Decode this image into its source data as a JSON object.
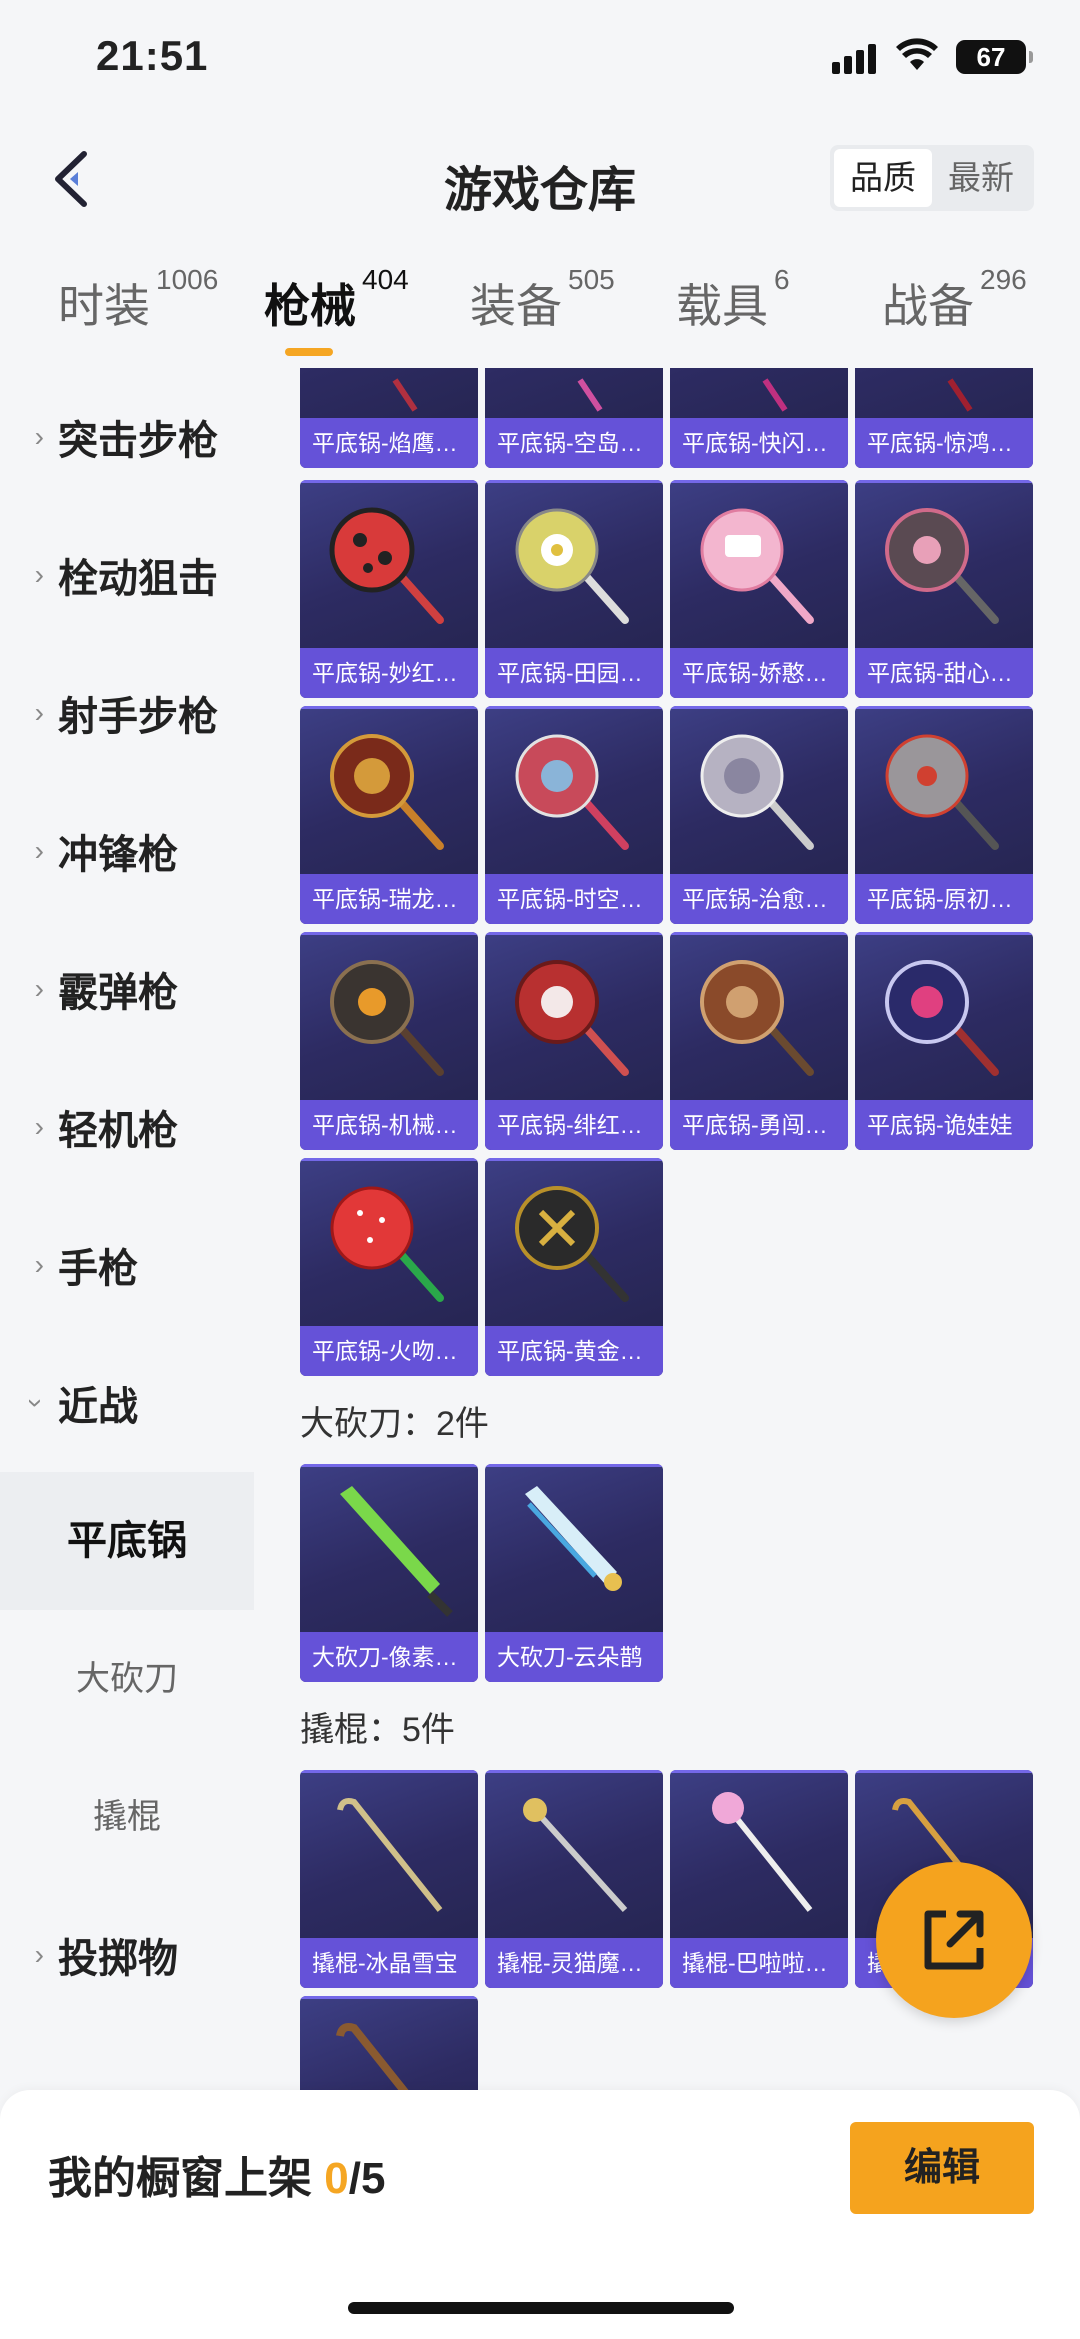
{
  "status_bar": {
    "time": "21:51",
    "battery": "67"
  },
  "nav": {
    "title": "游戏仓库",
    "sort_options": [
      "品质",
      "最新"
    ]
  },
  "tabs": [
    {
      "label": "时装",
      "count": "1006"
    },
    {
      "label": "枪械",
      "count": "404"
    },
    {
      "label": "装备",
      "count": "505"
    },
    {
      "label": "载具",
      "count": "6"
    },
    {
      "label": "战备",
      "count": "296"
    }
  ],
  "sidebar": {
    "items": [
      "突击步枪",
      "栓动狙击",
      "射手步枪",
      "冲锋枪",
      "霰弹枪",
      "轻机枪",
      "手枪",
      "近战"
    ],
    "sub_items": [
      "平底锅",
      "大砍刀",
      "撬棍"
    ],
    "last_item": "投掷物"
  },
  "sections": {
    "machete_label": "大砍刀：2件",
    "crowbar_label": "撬棍：5件"
  },
  "pans": [
    "平底锅-焰鹰…",
    "平底锅-空岛…",
    "平底锅-快闪…",
    "平底锅-惊鸿…",
    "平底锅-妙红…",
    "平底锅-田园…",
    "平底锅-娇憨…",
    "平底锅-甜心…",
    "平底锅-瑞龙…",
    "平底锅-时空…",
    "平底锅-治愈…",
    "平底锅-原初…",
    "平底锅-机械…",
    "平底锅-绯红…",
    "平底锅-勇闯…",
    "平底锅-诡娃娃",
    "平底锅-火吻…",
    "平底锅-黄金…"
  ],
  "machetes": [
    "大砍刀-像素…",
    "大砍刀-云朵鹊"
  ],
  "crowbars": [
    "撬棍-冰晶雪宝",
    "撬棍-灵猫魔…",
    "撬棍-巴啦啦…",
    "撬"
  ],
  "showcase": {
    "label_prefix": "我的橱窗上架 ",
    "current": "0",
    "total": "/5",
    "edit_label": "编辑"
  }
}
